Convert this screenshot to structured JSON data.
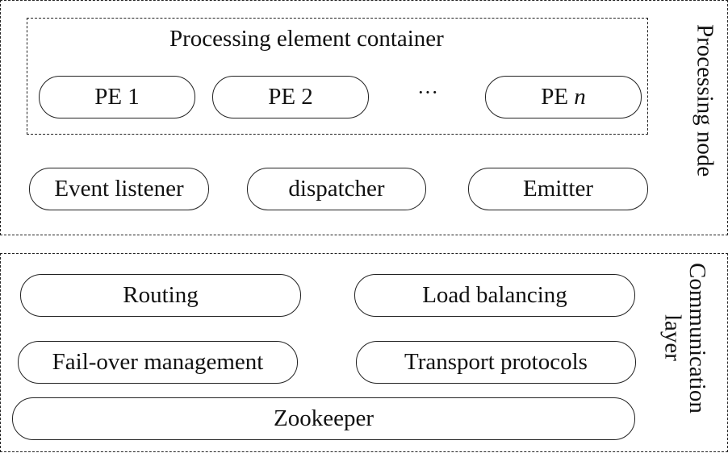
{
  "processing_node": {
    "label": "Processing node",
    "container": {
      "title": "Processing element container",
      "pe_prefix": "PE",
      "pe_items": [
        {
          "label": "PE 1"
        },
        {
          "label": "PE 2"
        }
      ],
      "ellipsis": "···",
      "pe_last_var": "n"
    },
    "components": [
      {
        "label": "Event listener"
      },
      {
        "label": "dispatcher"
      },
      {
        "label": "Emitter"
      }
    ]
  },
  "communication_layer": {
    "label_line1": "Communication",
    "label_line2": "layer",
    "components": [
      {
        "label": "Routing"
      },
      {
        "label": "Load balancing"
      },
      {
        "label": "Fail-over management"
      },
      {
        "label": "Transport protocols"
      },
      {
        "label": "Zookeeper"
      }
    ]
  }
}
